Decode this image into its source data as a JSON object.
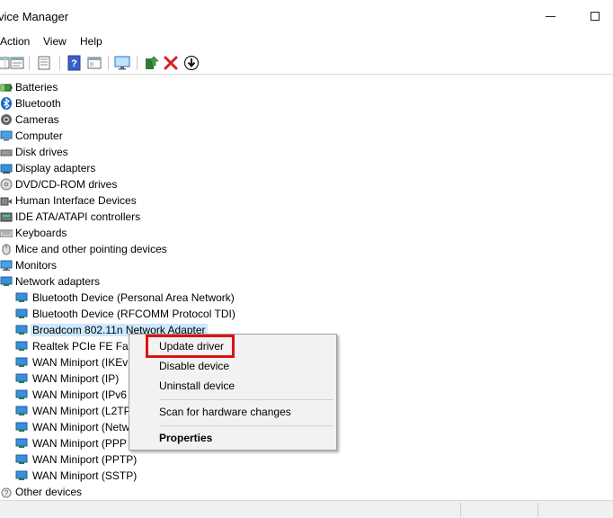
{
  "window": {
    "title": "vice Manager",
    "minimize_icon": "minimize-icon",
    "maximize_icon": "maximize-icon"
  },
  "menu": {
    "items": [
      "Action",
      "View",
      "Help"
    ]
  },
  "toolbar": {
    "icons": [
      "back-icon",
      "forward-icon",
      "properties-icon",
      "tree-view-icon",
      "help-icon",
      "tree-view-alt-icon",
      "monitor-icon",
      "update-driver-icon",
      "uninstall-icon",
      "download-icon"
    ]
  },
  "tree": {
    "categories": [
      {
        "label": "Batteries",
        "icon": "battery-icon"
      },
      {
        "label": "Bluetooth",
        "icon": "bluetooth-icon"
      },
      {
        "label": "Cameras",
        "icon": "camera-icon"
      },
      {
        "label": "Computer",
        "icon": "computer-icon"
      },
      {
        "label": "Disk drives",
        "icon": "disk-drive-icon"
      },
      {
        "label": "Display adapters",
        "icon": "display-adapter-icon"
      },
      {
        "label": "DVD/CD-ROM drives",
        "icon": "dvd-icon"
      },
      {
        "label": "Human Interface Devices",
        "icon": "hid-icon"
      },
      {
        "label": "IDE ATA/ATAPI controllers",
        "icon": "ide-controller-icon"
      },
      {
        "label": "Keyboards",
        "icon": "keyboard-icon"
      },
      {
        "label": "Mice and other pointing devices",
        "icon": "mouse-icon"
      },
      {
        "label": "Monitors",
        "icon": "monitor-icon"
      },
      {
        "label": "Network adapters",
        "icon": "network-adapter-icon"
      }
    ],
    "network_children": [
      {
        "label": "Bluetooth Device (Personal Area Network)"
      },
      {
        "label": "Bluetooth Device (RFCOMM Protocol TDI)"
      },
      {
        "label": "Broadcom 802.11n Network Adapter",
        "selected": true
      },
      {
        "label": "Realtek PCIe FE Fam"
      },
      {
        "label": "WAN Miniport (IKEv"
      },
      {
        "label": "WAN Miniport (IP)"
      },
      {
        "label": "WAN Miniport (IPv6"
      },
      {
        "label": "WAN Miniport (L2TP"
      },
      {
        "label": "WAN Miniport (Netw"
      },
      {
        "label": "WAN Miniport (PPP"
      },
      {
        "label": "WAN Miniport (PPTP)"
      },
      {
        "label": "WAN Miniport (SSTP)"
      }
    ],
    "after": {
      "label": "Other devices",
      "icon": "other-devices-icon"
    }
  },
  "context_menu": {
    "update_driver": "Update driver",
    "disable_device": "Disable device",
    "uninstall_device": "Uninstall device",
    "scan_hardware": "Scan for hardware changes",
    "properties": "Properties"
  },
  "colors": {
    "highlight_border": "#e01010",
    "selection": "#cde8ff",
    "network_icon": "#3a8fd8"
  }
}
